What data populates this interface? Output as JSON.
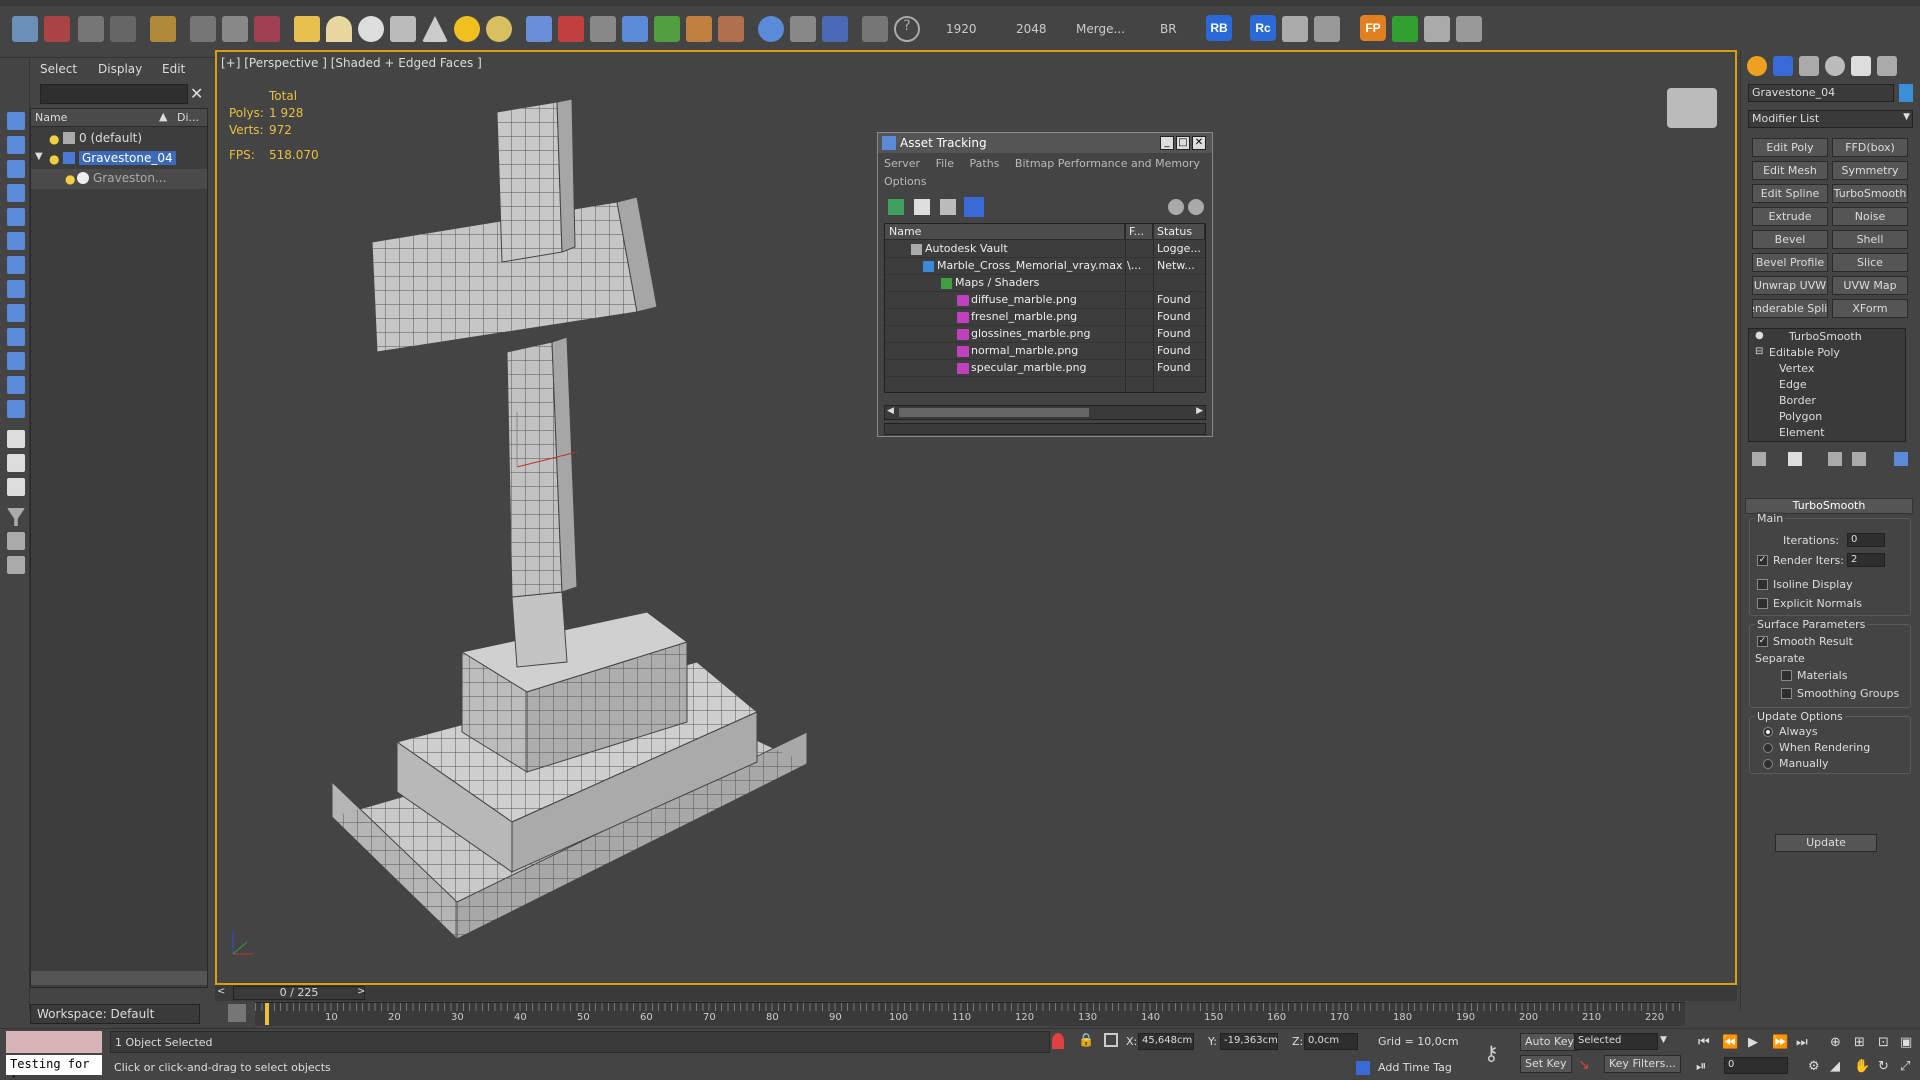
{
  "toolbar": {
    "render_width": "1920",
    "render_height": "2048",
    "merge_label": "Merge...",
    "br_label": "BR",
    "rb_badge": "RB",
    "rc_badge": "Rc",
    "fp_badge": "FP",
    "help_icon": "question-icon"
  },
  "explorer": {
    "menu": [
      "Select",
      "Display",
      "Edit"
    ],
    "col_name": "Name",
    "col_display": "Di...",
    "layers": [
      {
        "label": "0 (default)"
      },
      {
        "label": "Gravestone_04"
      },
      {
        "label": "Graveston..."
      }
    ],
    "workspace": "Workspace: Default"
  },
  "viewport": {
    "label": "[+] [Perspective ] [Shaded + Edged Faces ]",
    "stats": {
      "total_label": "Total",
      "polys_label": "Polys:",
      "polys_value": "1 928",
      "verts_label": "Verts:",
      "verts_value": "972",
      "fps_label": "FPS:",
      "fps_value": "518.070"
    }
  },
  "asset_tracking": {
    "title": "Asset Tracking",
    "menu_row1": [
      "Server",
      "File",
      "Paths",
      "Bitmap Performance and Memory"
    ],
    "menu_row2": [
      "Options"
    ],
    "columns": [
      "Name",
      "F...",
      "Status"
    ],
    "rows": [
      {
        "name": "Autodesk Vault",
        "f": "",
        "status": "Logge..."
      },
      {
        "name": "Marble_Cross_Memorial_vray.max",
        "f": "\\...",
        "status": "Netw..."
      },
      {
        "name": "Maps / Shaders",
        "f": "",
        "status": ""
      },
      {
        "name": "diffuse_marble.png",
        "f": "",
        "status": "Found"
      },
      {
        "name": "fresnel_marble.png",
        "f": "",
        "status": "Found"
      },
      {
        "name": "glossines_marble.png",
        "f": "",
        "status": "Found"
      },
      {
        "name": "normal_marble.png",
        "f": "",
        "status": "Found"
      },
      {
        "name": "specular_marble.png",
        "f": "",
        "status": "Found"
      }
    ]
  },
  "command_panel": {
    "object_name": "Gravestone_04",
    "modifier_list": "Modifier List",
    "modifier_buttons": [
      "Edit Poly",
      "FFD(box)",
      "Edit Mesh",
      "Symmetry",
      "Edit Spline",
      "TurboSmooth",
      "Extrude",
      "Noise",
      "Bevel",
      "Shell",
      "Bevel Profile",
      "Slice",
      "Unwrap UVW",
      "UVW Map",
      "enderable Splir",
      "XForm"
    ],
    "stack": [
      "TurboSmooth",
      "Editable Poly",
      "Vertex",
      "Edge",
      "Border",
      "Polygon",
      "Element"
    ],
    "turbosmooth": {
      "title": "TurboSmooth",
      "main_label": "Main",
      "iterations_label": "Iterations:",
      "iterations_value": "0",
      "render_iters_label": "Render Iters:",
      "render_iters_value": "2",
      "isoline_label": "Isoline Display",
      "explicit_normals_label": "Explicit Normals",
      "surface_params_label": "Surface Parameters",
      "smooth_result_label": "Smooth Result",
      "separate_label": "Separate",
      "materials_label": "Materials",
      "smoothing_groups_label": "Smoothing Groups",
      "update_options_label": "Update Options",
      "always_label": "Always",
      "when_rendering_label": "When Rendering",
      "manually_label": "Manually",
      "update_button": "Update"
    }
  },
  "timeline": {
    "frame_display": "0 / 225",
    "ticks": [
      "10",
      "20",
      "30",
      "40",
      "50",
      "60",
      "70",
      "80",
      "90",
      "100",
      "110",
      "120",
      "130",
      "140",
      "150",
      "160",
      "170",
      "180",
      "190",
      "200",
      "210",
      "220"
    ]
  },
  "statusbar": {
    "script_text": "Testing for :",
    "selection": "1 Object Selected",
    "prompt": "Click or click-and-drag to select objects",
    "x_label": "X:",
    "x_value": "45,648cm",
    "y_label": "Y:",
    "y_value": "-19,363cm",
    "z_label": "Z:",
    "z_value": "0,0cm",
    "grid": "Grid = 10,0cm",
    "add_time_tag": "Add Time Tag",
    "auto_key": "Auto Key",
    "set_key": "Set Key",
    "selected": "Selected",
    "key_filters": "Key Filters...",
    "frame_field": "0"
  }
}
